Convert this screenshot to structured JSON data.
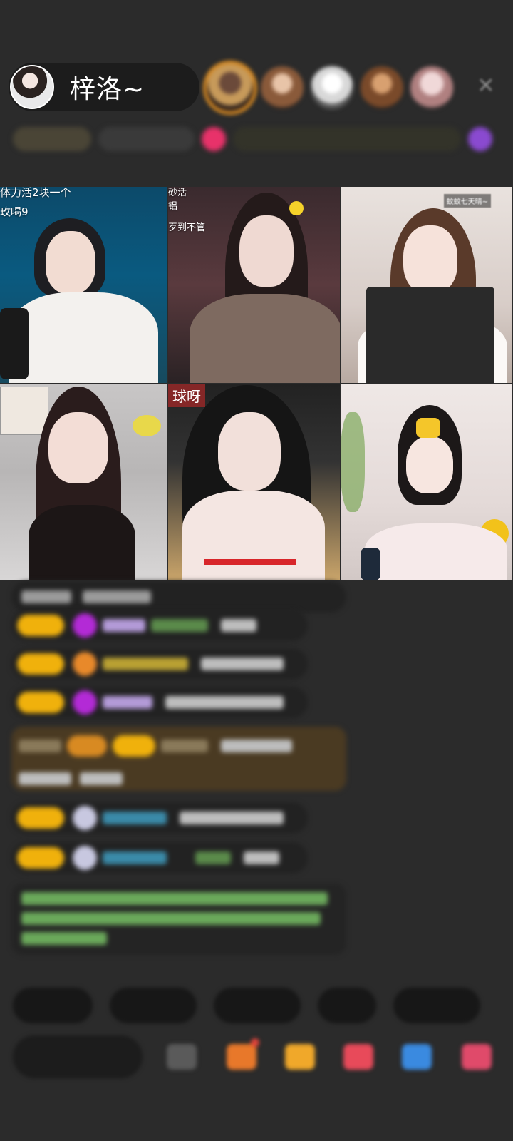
{
  "host": {
    "name": "梓洛~"
  },
  "tiles": [
    {
      "label_top": "体力活2块一个",
      "label_second": "玫喝9"
    },
    {
      "label_lines": [
        "砂活",
        "铝",
        "歹到不管"
      ]
    },
    {
      "badge": "蚊蚊七天晴~"
    },
    {},
    {
      "tag": "球呀"
    },
    {}
  ],
  "icons": {
    "close": "close-icon"
  },
  "colors": {
    "background": "#2b2b2b",
    "level_badge": "#f0b10c",
    "purple_gem": "#b32ad6",
    "notification_red": "#e0443a"
  }
}
